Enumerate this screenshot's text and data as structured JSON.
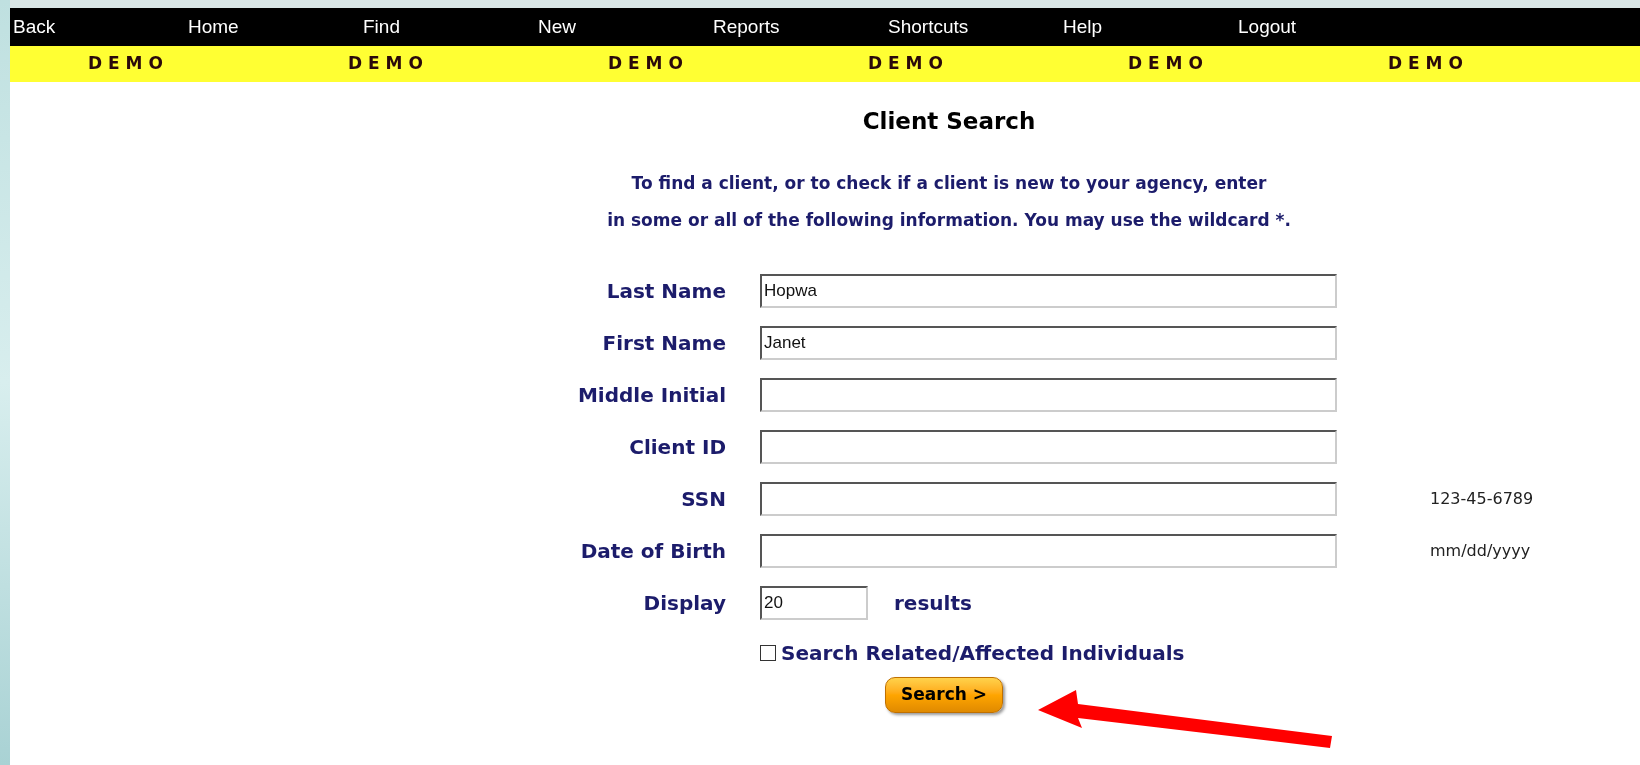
{
  "nav": {
    "items": [
      "Back",
      "Home",
      "Find",
      "New",
      "Reports",
      "Shortcuts",
      "Help",
      "Logout"
    ]
  },
  "banner": {
    "items": [
      "D E M O",
      "D E M O",
      "D E M O",
      "D E M O",
      "D E M O",
      "D E M O"
    ]
  },
  "title": "Client Search",
  "instructions": [
    "To find a client, or to check if a client is new to your agency, enter",
    "in some or all of the following information. You may use the wildcard *."
  ],
  "fields": [
    {
      "label": "Last Name",
      "value": "Hopwa"
    },
    {
      "label": "First Name",
      "value": "Janet"
    },
    {
      "label": "Middle Initial"
    },
    {
      "label": "Client ID"
    },
    {
      "label": "SSN",
      "hint": "123-45-6789"
    },
    {
      "label": "Date of Birth",
      "hint": "mm/dd/yyyy"
    }
  ],
  "display": {
    "label": "Display",
    "value": "20",
    "suffix": "results"
  },
  "related": {
    "label": "Search Related/Affected Individuals",
    "checked": false
  },
  "search_button": "Search >"
}
